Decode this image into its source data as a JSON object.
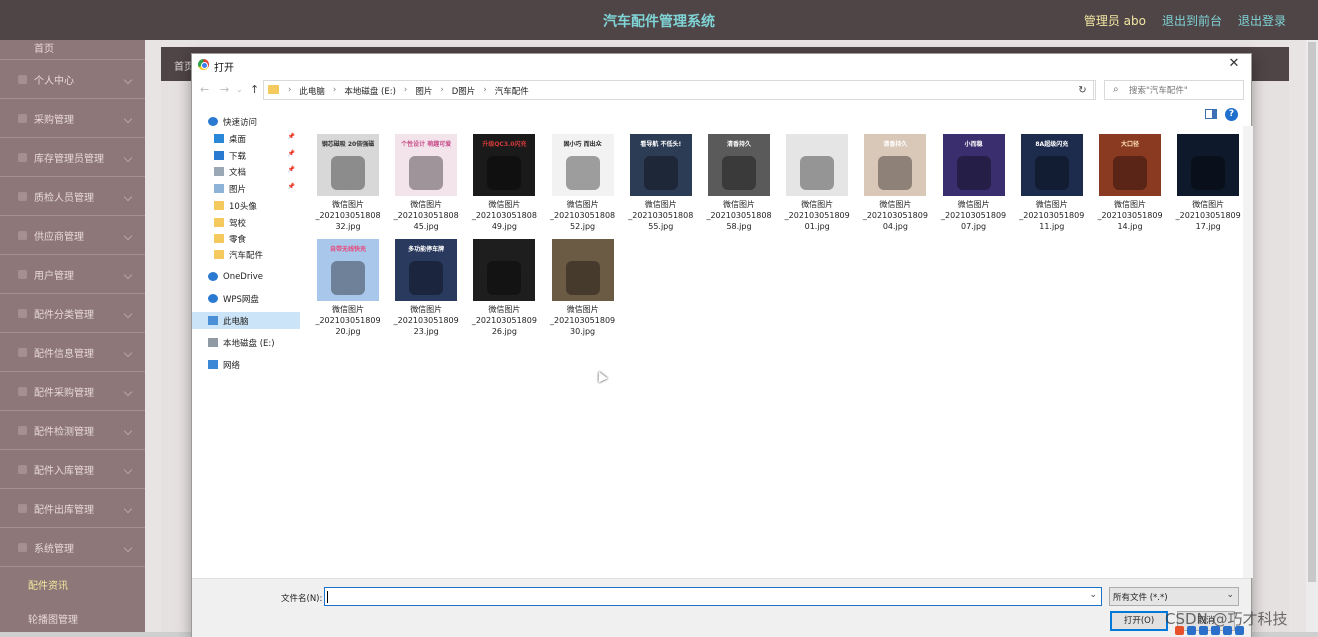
{
  "header": {
    "title": "汽车配件管理系统",
    "admin": "管理员 abo",
    "back_link": "退出到前台",
    "logout": "退出登录"
  },
  "sidebar": {
    "items": [
      {
        "label": "首页"
      },
      {
        "label": "个人中心"
      },
      {
        "label": "采购管理"
      },
      {
        "label": "库存管理员管理"
      },
      {
        "label": "质检人员管理"
      },
      {
        "label": "供应商管理"
      },
      {
        "label": "用户管理"
      },
      {
        "label": "配件分类管理"
      },
      {
        "label": "配件信息管理"
      },
      {
        "label": "配件采购管理"
      },
      {
        "label": "配件检测管理"
      },
      {
        "label": "配件入库管理"
      },
      {
        "label": "配件出库管理"
      },
      {
        "label": "系统管理"
      }
    ],
    "subitems": [
      {
        "label": "配件资讯"
      },
      {
        "label": "轮播图管理"
      }
    ]
  },
  "content": {
    "breadcrumb": "首页"
  },
  "dialog": {
    "title": "打开",
    "address": [
      "此电脑",
      "本地磁盘 (E:)",
      "图片",
      "D图片",
      "汽车配件"
    ],
    "search_placeholder": "搜索\"汽车配件\"",
    "nav": [
      {
        "label": "快速访问",
        "icon": "star-icon",
        "pinned": false
      },
      {
        "label": "桌面",
        "icon": "desktop-icon",
        "pinned": true
      },
      {
        "label": "下载",
        "icon": "download-icon",
        "pinned": true
      },
      {
        "label": "文档",
        "icon": "document-icon",
        "pinned": true
      },
      {
        "label": "图片",
        "icon": "pictures-icon",
        "pinned": true
      },
      {
        "label": "10头像",
        "icon": "folder-icon",
        "pinned": false
      },
      {
        "label": "驾校",
        "icon": "folder-icon",
        "pinned": false
      },
      {
        "label": "零食",
        "icon": "folder-icon",
        "pinned": false
      },
      {
        "label": "汽车配件",
        "icon": "folder-icon",
        "pinned": false
      },
      {
        "label": "OneDrive",
        "icon": "cloud-icon",
        "pinned": false
      },
      {
        "label": "WPS网盘",
        "icon": "cloud-icon",
        "pinned": false
      },
      {
        "label": "此电脑",
        "icon": "computer-icon",
        "pinned": false
      },
      {
        "label": "本地磁盘 (E:)",
        "icon": "drive-icon",
        "pinned": false
      },
      {
        "label": "网络",
        "icon": "network-icon",
        "pinned": false
      }
    ],
    "files": [
      {
        "name": "微信图片_2021030518083 2.jpg",
        "line1": "微信图片",
        "line2": "_202103051808",
        "line3": "32.jpg",
        "bg": "#d8d8d8",
        "fg": "#333333",
        "text": "钢芯磁吸 20倍强磁"
      },
      {
        "name": "45",
        "line1": "微信图片",
        "line2": "_202103051808",
        "line3": "45.jpg",
        "bg": "#f3e4ec",
        "fg": "#c84f8a",
        "text": "个性设计 萌趣可爱"
      },
      {
        "name": "49",
        "line1": "微信图片",
        "line2": "_202103051808",
        "line3": "49.jpg",
        "bg": "#1a1a1a",
        "fg": "#d23a3a",
        "text": "升级QC3.0闪充"
      },
      {
        "name": "52",
        "line1": "微信图片",
        "line2": "_202103051808",
        "line3": "52.jpg",
        "bg": "#f2f2f2",
        "fg": "#222222",
        "text": "固小巧 而出众"
      },
      {
        "name": "55",
        "line1": "微信图片",
        "line2": "_202103051808",
        "line3": "55.jpg",
        "bg": "#2d3c55",
        "fg": "#ffffff",
        "text": "看导航 不低头!"
      },
      {
        "name": "58",
        "line1": "微信图片",
        "line2": "_202103051808",
        "line3": "58.jpg",
        "bg": "#5a5a5a",
        "fg": "#ffffff",
        "text": "清香持久"
      },
      {
        "name": "01",
        "line1": "微信图片",
        "line2": "_202103051809",
        "line3": "01.jpg",
        "bg": "#e5e5e5",
        "fg": "#555555",
        "text": ""
      },
      {
        "name": "04",
        "line1": "微信图片",
        "line2": "_202103051809",
        "line3": "04.jpg",
        "bg": "#d9c7b8",
        "fg": "#ffffff",
        "text": "清香持久"
      },
      {
        "name": "07",
        "line1": "微信图片",
        "line2": "_202103051809",
        "line3": "07.jpg",
        "bg": "#3a2e6e",
        "fg": "#ffffff",
        "text": "小而稳"
      },
      {
        "name": "11",
        "line1": "微信图片",
        "line2": "_202103051809",
        "line3": "11.jpg",
        "bg": "#1d2b4d",
        "fg": "#ffffff",
        "text": "8A超级闪充"
      },
      {
        "name": "14",
        "line1": "微信图片",
        "line2": "_202103051809",
        "line3": "14.jpg",
        "bg": "#8b3a22",
        "fg": "#ffe2b8",
        "text": "大口径"
      },
      {
        "name": "17",
        "line1": "微信图片",
        "line2": "_202103051809",
        "line3": "17.jpg",
        "bg": "#0e1a2b",
        "fg": "#5fa8ff",
        "text": ""
      },
      {
        "name": "20",
        "line1": "微信图片",
        "line2": "_202103051809",
        "line3": "20.jpg",
        "bg": "#a9c7ea",
        "fg": "#e8477c",
        "text": "自带无线快充"
      },
      {
        "name": "23",
        "line1": "微信图片",
        "line2": "_202103051809",
        "line3": "23.jpg",
        "bg": "#2a3a5e",
        "fg": "#ffffff",
        "text": "多功能停车牌"
      },
      {
        "name": "26",
        "line1": "微信图片",
        "line2": "_202103051809",
        "line3": "26.jpg",
        "bg": "#1e1e1e",
        "fg": "#ffffff",
        "text": ""
      },
      {
        "name": "30",
        "line1": "微信图片",
        "line2": "_202103051809",
        "line3": "30.jpg",
        "bg": "#6b5a44",
        "fg": "#ffffff",
        "text": ""
      }
    ],
    "filename_label": "文件名(N):",
    "filename_value": "",
    "filetype": "所有文件 (*.*)",
    "open_button": "打开(O)",
    "cancel_button": "取消"
  },
  "watermark": "CSDN @巧才科技",
  "colors": {
    "header_bg": "#4f4446",
    "sidebar_bg": "#8d7778",
    "title_accent": "#7fd4d6",
    "admin_yellow": "#f2e7a2"
  }
}
